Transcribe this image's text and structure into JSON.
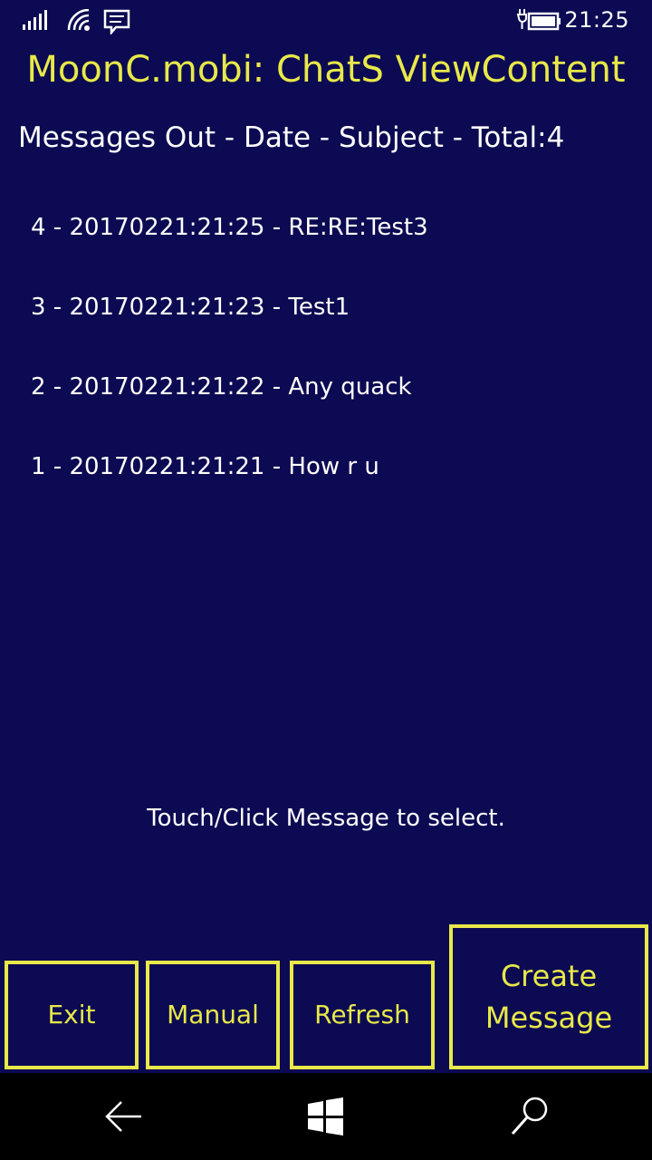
{
  "status_bar": {
    "time": "21:25",
    "icons": [
      "signal-icon",
      "wifi-icon",
      "message-icon",
      "battery-charging-icon"
    ]
  },
  "app": {
    "title": "MoonC.mobi: ChatS ViewContent"
  },
  "list": {
    "header": "Messages Out - Date - Subject - Total:4",
    "items": [
      "4 - 20170221:21:25 - RE:RE:Test3",
      "3 - 20170221:21:23 - Test1",
      "2 - 20170221:21:22 - Any quack",
      "1 - 20170221:21:21 - How r u"
    ]
  },
  "hint": "Touch/Click Message to select.",
  "buttons": {
    "exit": "Exit",
    "manual": "Manual",
    "refresh": "Refresh",
    "create": "Create Message"
  },
  "nav": {
    "icons": [
      "back-icon",
      "windows-home-icon",
      "search-icon"
    ]
  },
  "colors": {
    "background": "#0b0a52",
    "accent": "#e8e84a",
    "text": "#ffffff",
    "nav_background": "#000000"
  }
}
